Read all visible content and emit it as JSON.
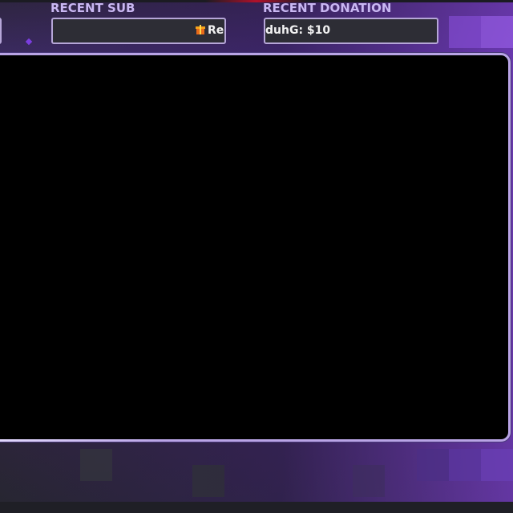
{
  "widgets": {
    "recent_sub": {
      "label": "RECENT SUB",
      "ticker_text": "Re"
    },
    "recent_donation": {
      "label": "RECENT DONATION",
      "ticker_text": "duhG: $10"
    }
  },
  "icons": {
    "gift": "gift-icon"
  },
  "colors": {
    "label": "#c9b7f2",
    "frame_border": "#b9a4e6",
    "accent_red": "#b0112b",
    "purple": "#7b3de0"
  }
}
